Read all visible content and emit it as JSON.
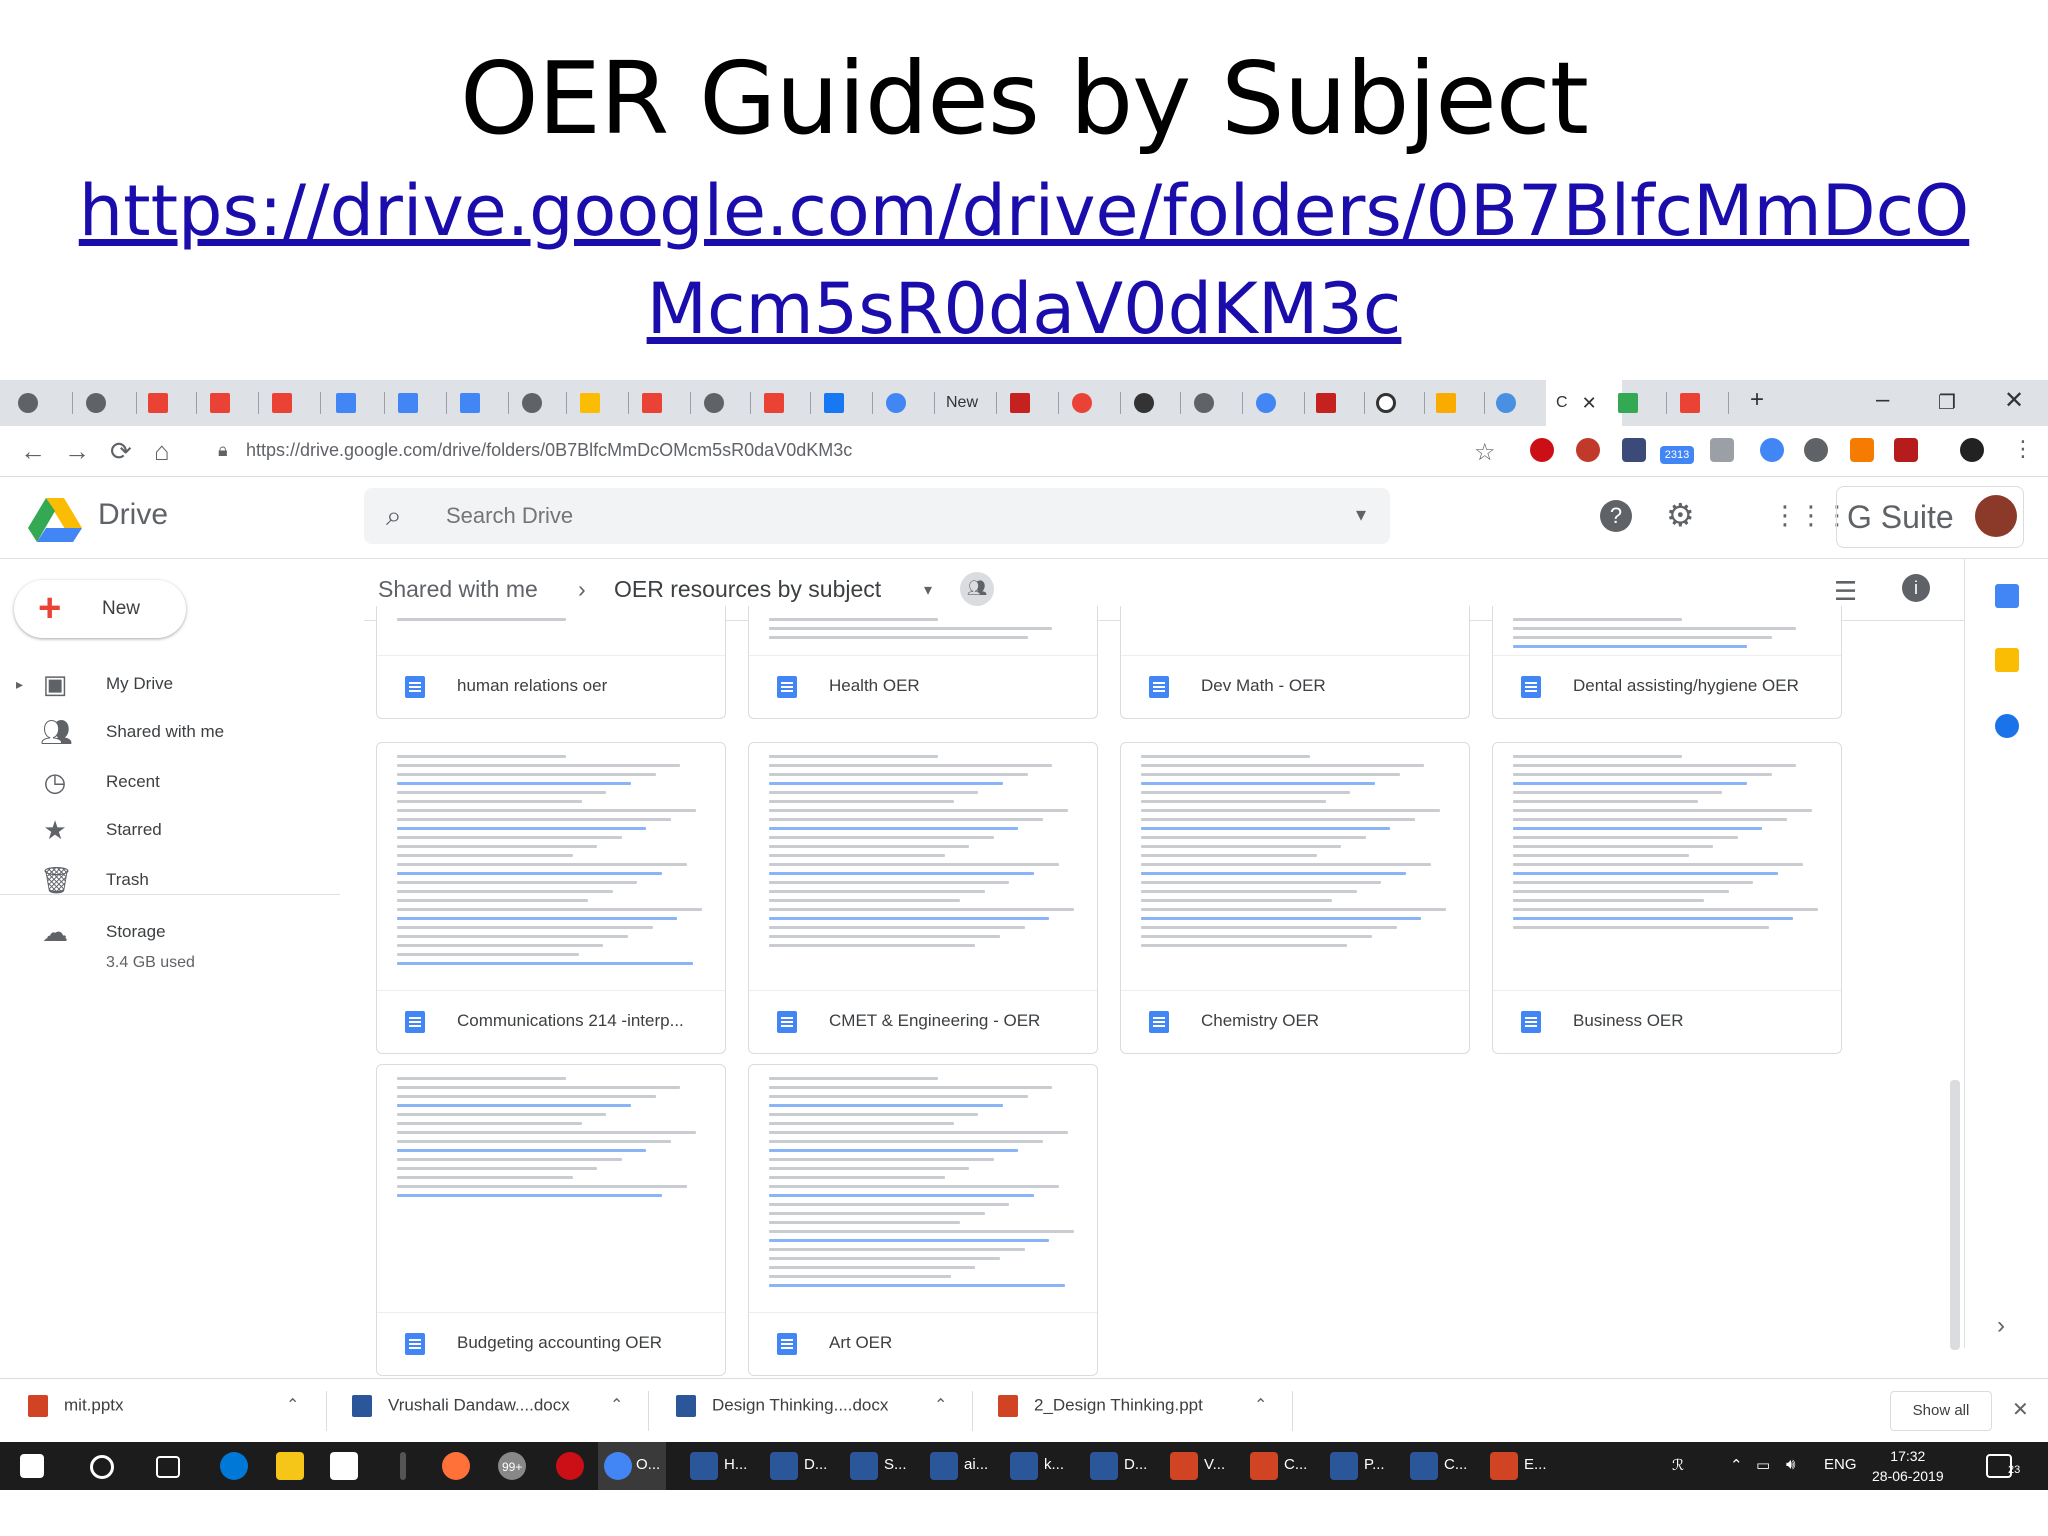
{
  "slide": {
    "title": "OER Guides by Subject",
    "link_line1": "https://drive.google.com/drive/folders/0B7BlfcMmDcO",
    "link_line2": "Mcm5sR0daV0dKM3c"
  },
  "browser": {
    "tab_new_label": "New",
    "active_tab_label": "C",
    "url": "https://drive.google.com/drive/folders/0B7BlfcMmDcOMcm5sR0daV0dKM3c",
    "ext_badge": "2313"
  },
  "drive": {
    "logo_text": "Drive",
    "search_placeholder": "Search Drive",
    "gsuite_text": "G Suite",
    "new_label": "New",
    "nav": [
      {
        "label": "My Drive"
      },
      {
        "label": "Shared with me"
      },
      {
        "label": "Recent"
      },
      {
        "label": "Starred"
      },
      {
        "label": "Trash"
      },
      {
        "label": "Storage"
      }
    ],
    "storage_used": "3.4 GB used",
    "breadcrumb": {
      "root": "Shared with me",
      "current": "OER resources by subject"
    },
    "files": [
      {
        "name": "human relations oer"
      },
      {
        "name": "Health OER"
      },
      {
        "name": "Dev Math - OER"
      },
      {
        "name": "Dental assisting/hygiene OER"
      },
      {
        "name": "Communications 214 -interp..."
      },
      {
        "name": "CMET & Engineering - OER"
      },
      {
        "name": "Chemistry OER"
      },
      {
        "name": "Business OER"
      },
      {
        "name": "Budgeting accounting OER"
      },
      {
        "name": "Art OER"
      }
    ]
  },
  "downloads": {
    "items": [
      {
        "name": "mit.pptx"
      },
      {
        "name": "Vrushali Dandaw....docx"
      },
      {
        "name": "Design Thinking....docx"
      },
      {
        "name": "2_Design Thinking.ppt"
      }
    ],
    "show_all": "Show all"
  },
  "taskbar": {
    "badge": "99+",
    "labels": [
      "O...",
      "H...",
      "D...",
      "S...",
      "ai...",
      "k...",
      "D...",
      "V...",
      "C...",
      "P...",
      "C...",
      "E..."
    ],
    "lang": "ENG",
    "time": "17:32",
    "date": "28-06-2019",
    "notif_count": "23"
  }
}
